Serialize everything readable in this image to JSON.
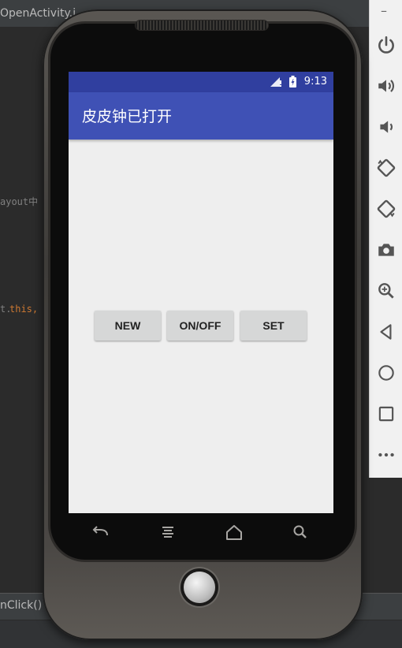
{
  "ide": {
    "tab_title": "OpenActivity.j",
    "code_fragment_1": "ayout中",
    "code_fragment_2": "t.",
    "code_fragment_3": "this,",
    "method_crumb": "nClick()"
  },
  "side_panel": {
    "minimize_label": "–",
    "buttons": [
      "power-icon",
      "volume-up-icon",
      "volume-down-icon",
      "rotate-left-icon",
      "rotate-right-icon",
      "camera-icon",
      "zoom-icon",
      "back-icon",
      "home-icon",
      "overview-icon",
      "more-icon"
    ]
  },
  "phone": {
    "status_bar": {
      "time": "9:13",
      "color": "#303f9f"
    },
    "app_bar": {
      "title": "皮皮钟已打开",
      "color": "#3f51b5"
    },
    "buttons": [
      {
        "label": "NEW"
      },
      {
        "label": "ON/OFF"
      },
      {
        "label": "SET"
      }
    ],
    "screen_background": "#eeeeee"
  }
}
